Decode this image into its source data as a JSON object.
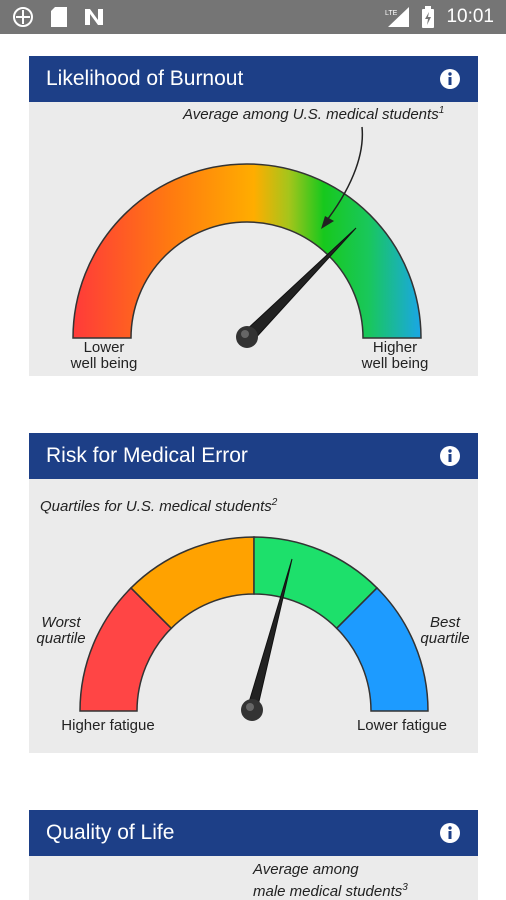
{
  "status_bar": {
    "time": "10:01",
    "icons": [
      "globe-icon",
      "sd-card-icon",
      "n-notification-icon",
      "lte-signal-icon",
      "battery-charging-icon"
    ],
    "network_label": "LTE"
  },
  "cards": [
    {
      "title": "Likelihood of Burnout",
      "info_icon": "info-icon",
      "caption": "Average among U.S. medical students",
      "caption_ref": "1",
      "left_label": [
        "Lower",
        "well being"
      ],
      "right_label": [
        "Higher",
        "well being"
      ],
      "needle_value": 0.78
    },
    {
      "title": "Risk for Medical Error",
      "info_icon": "info-icon",
      "caption": "Quartiles for U.S. medical students",
      "caption_ref": "2",
      "left_side_label": [
        "Worst",
        "quartile"
      ],
      "right_side_label": [
        "Best",
        "quartile"
      ],
      "left_label": "Higher fatigue",
      "right_label": "Lower fatigue",
      "quartile_colors": [
        "#ff4545",
        "#ffa200",
        "#1de06b",
        "#1d9bff"
      ],
      "needle_value": 0.56
    },
    {
      "title": "Quality of Life",
      "info_icon": "info-icon",
      "caption": [
        "Average among",
        "male medical students"
      ],
      "caption_ref": "3"
    }
  ]
}
